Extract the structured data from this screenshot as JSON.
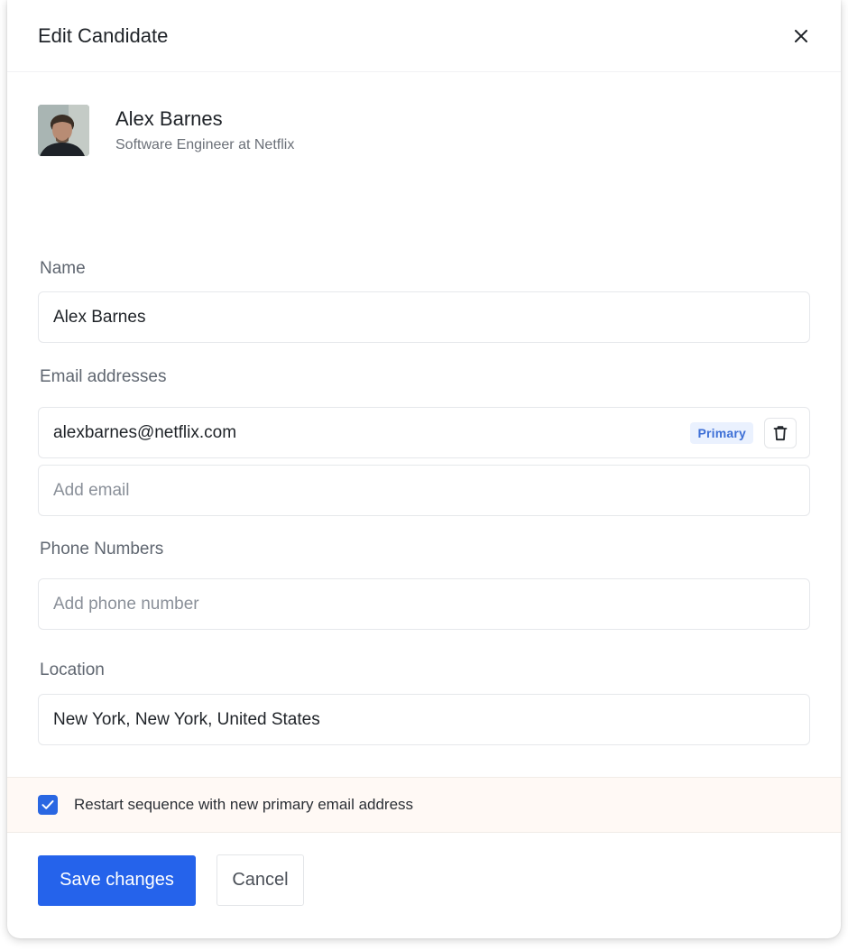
{
  "header": {
    "title": "Edit Candidate",
    "close_icon": "close-icon"
  },
  "profile": {
    "name": "Alex Barnes",
    "subtitle": "Software Engineer at Netflix"
  },
  "form": {
    "name": {
      "label": "Name",
      "value": "Alex Barnes"
    },
    "emails": {
      "label": "Email addresses",
      "primary_value": "alexbarnes@netflix.com",
      "primary_badge": "Primary",
      "add_placeholder": "Add email"
    },
    "phones": {
      "label": "Phone Numbers",
      "placeholder": "Add phone number"
    },
    "location": {
      "label": "Location",
      "value": "New York, New York, United States"
    }
  },
  "restart": {
    "checked": true,
    "label": "Restart sequence with new primary email address"
  },
  "footer": {
    "save_label": "Save changes",
    "cancel_label": "Cancel"
  },
  "colors": {
    "primary": "#2563eb",
    "checkbox": "#2a67e2",
    "badge_bg": "#eaf1fe",
    "badge_text": "#3d6fd6",
    "restart_bg": "#fff9f5"
  }
}
